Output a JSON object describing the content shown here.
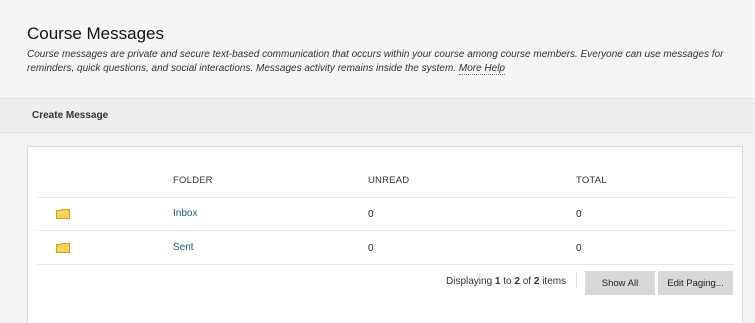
{
  "header": {
    "title": "Course Messages",
    "description": "Course messages are private and secure text-based communication that occurs within your course among course members. Everyone can use messages for reminders, quick questions, and social interactions. Messages activity remains inside the system.",
    "more_help": "More Help"
  },
  "action_bar": {
    "create_message": "Create Message"
  },
  "table": {
    "columns": {
      "folder": "FOLDER",
      "unread": "UNREAD",
      "total": "TOTAL"
    },
    "rows": [
      {
        "icon": "folder-icon",
        "folder": "Inbox",
        "unread": "0",
        "total": "0"
      },
      {
        "icon": "folder-icon",
        "folder": "Sent",
        "unread": "0",
        "total": "0"
      }
    ]
  },
  "paging": {
    "prefix": "Displaying",
    "from": "1",
    "to_word": "to",
    "to": "2",
    "of_word": "of",
    "total": "2",
    "suffix": "items",
    "show_all": "Show All",
    "edit_paging": "Edit Paging..."
  },
  "colors": {
    "link": "#1a5a8a",
    "folder_fill": "#f7d352",
    "folder_stroke": "#c9a227"
  }
}
